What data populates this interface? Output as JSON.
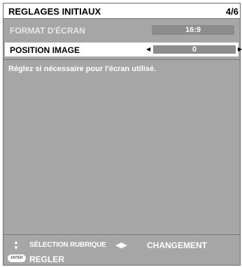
{
  "menu": {
    "title": "REGLAGES INITIAUX",
    "page": "4/6"
  },
  "items": [
    {
      "label": "FORMAT D'ÉCRAN",
      "value": "16:9"
    },
    {
      "label": "POSITION IMAGE",
      "value": "0",
      "left_arrow": "◀",
      "right_arrow": "▶"
    }
  ],
  "hint": "Réglez si nécessaire pour l'écran utilisé.",
  "footer": {
    "updown_icon": "updown-arrows-icon",
    "select_label": "SÉLECTION RUBRIQUE",
    "leftright_icon": "◀▶",
    "change_label": "CHANGEMENT",
    "enter_icon": "ENTER",
    "set_label": "REGLER"
  }
}
